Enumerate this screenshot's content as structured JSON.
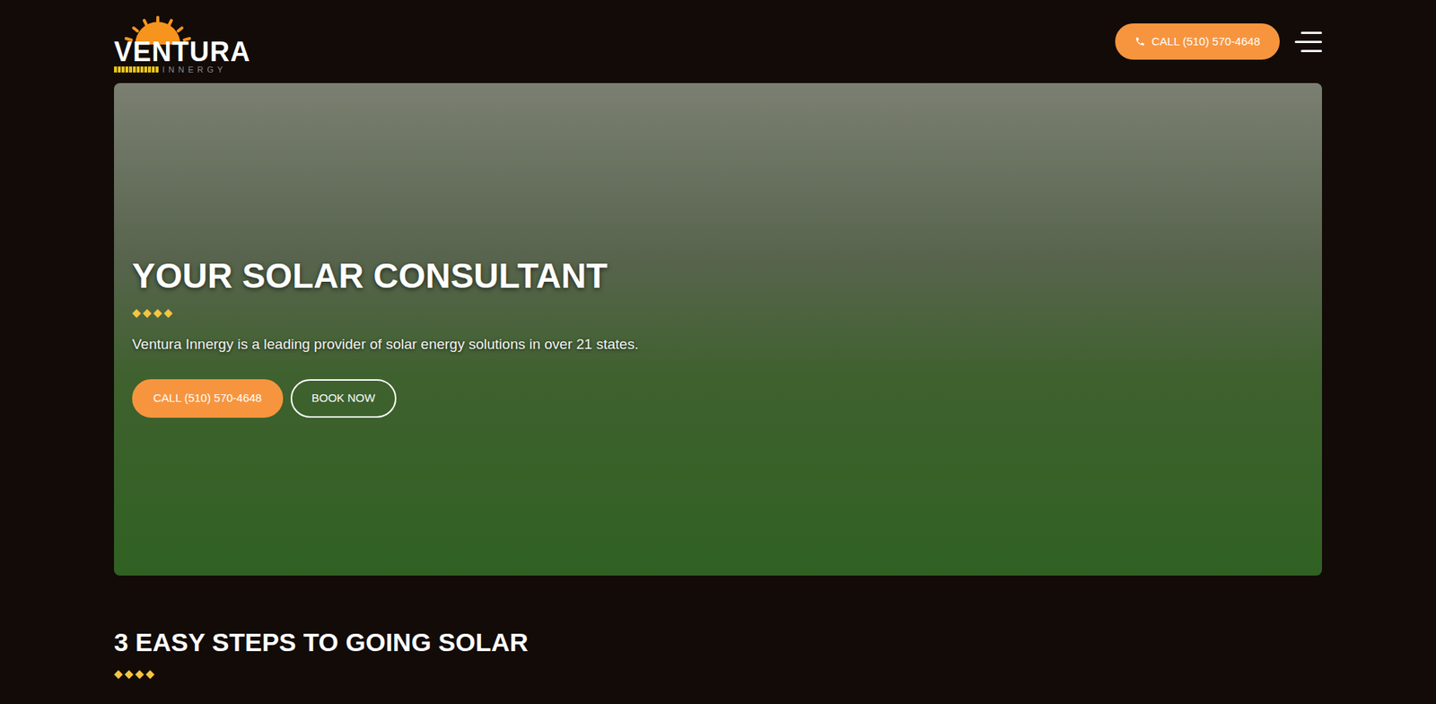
{
  "header": {
    "logo": {
      "name": "VENTURA",
      "tagline": "INNERGY"
    },
    "call_button": "CALL (510) 570-4648"
  },
  "hero": {
    "title": "YOUR SOLAR CONSULTANT",
    "diamonds": "◆◆◆◆",
    "subtitle": "Ventura Innergy is a leading provider of solar energy solutions in over 21 states.",
    "buttons": [
      {
        "label": "CALL (510) 570-4648",
        "kind": "primary"
      },
      {
        "label": "BOOK NOW",
        "kind": "outline"
      }
    ]
  },
  "steps": {
    "title": "3 EASY STEPS TO GOING SOLAR",
    "diamonds": "◆◆◆◆"
  }
}
